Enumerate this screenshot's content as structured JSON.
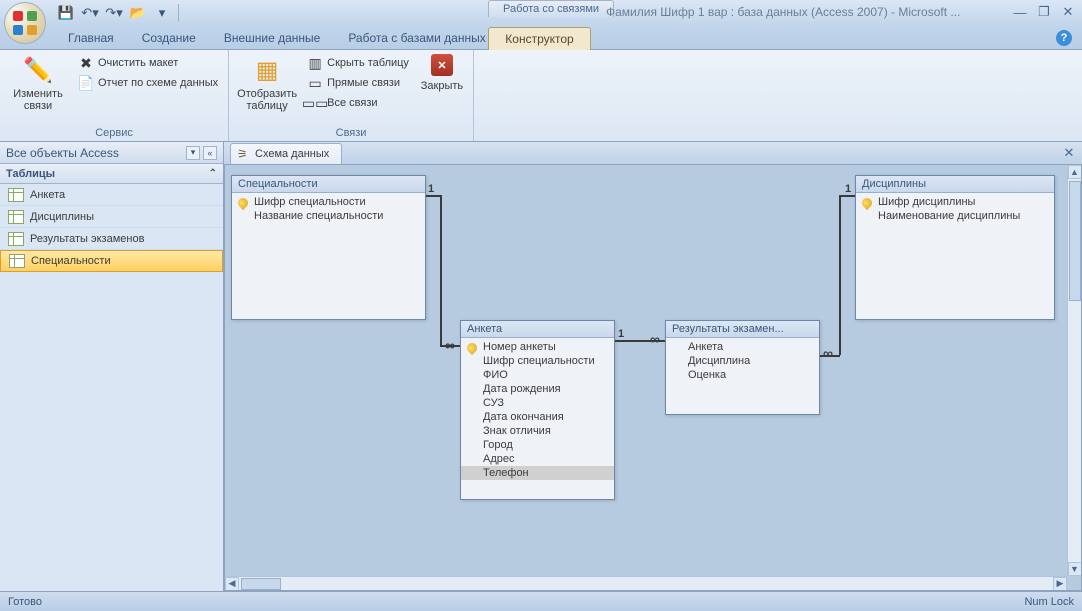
{
  "window": {
    "context_tab_title": "Работа со связями",
    "title": "Фамилия Шифр 1 вар : база данных (Access 2007) - Microsoft ..."
  },
  "qat": {
    "save": "save",
    "undo": "undo",
    "redo": "redo",
    "open": "open"
  },
  "tabs": {
    "home": "Главная",
    "create": "Создание",
    "external": "Внешние данные",
    "dbtools": "Работа с базами данных",
    "designer": "Конструктор"
  },
  "ribbon": {
    "group_service": "Сервис",
    "group_links": "Связи",
    "edit_links": "Изменить связи",
    "clear_layout": "Очистить макет",
    "schema_report": "Отчет по схеме данных",
    "show_table": "Отобразить таблицу",
    "hide_table": "Скрыть таблицу",
    "direct_links": "Прямые связи",
    "all_links": "Все связи",
    "close": "Закрыть"
  },
  "nav": {
    "header": "Все объекты Access",
    "section_tables": "Таблицы",
    "items": [
      "Анкета",
      "Дисциплины",
      "Результаты экзаменов",
      "Специальности"
    ],
    "selected_index": 3
  },
  "doc_tab": "Схема данных",
  "diagram": {
    "spec": {
      "title": "Специальности",
      "fields": [
        {
          "name": "Шифр специальности",
          "pk": true
        },
        {
          "name": "Название специальности",
          "pk": false
        }
      ]
    },
    "disc": {
      "title": "Дисциплины",
      "fields": [
        {
          "name": "Шифр дисциплины",
          "pk": true
        },
        {
          "name": "Наименование дисциплины",
          "pk": false
        }
      ]
    },
    "anketa": {
      "title": "Анкета",
      "fields": [
        {
          "name": "Номер анкеты",
          "pk": true
        },
        {
          "name": "Шифр специальности",
          "pk": false
        },
        {
          "name": "ФИО",
          "pk": false
        },
        {
          "name": "Дата рождения",
          "pk": false
        },
        {
          "name": "СУЗ",
          "pk": false
        },
        {
          "name": "Дата окончания",
          "pk": false
        },
        {
          "name": "Знак отличия",
          "pk": false
        },
        {
          "name": "Город",
          "pk": false
        },
        {
          "name": "Адрес",
          "pk": false
        },
        {
          "name": "Телефон",
          "pk": false,
          "sel": true
        }
      ]
    },
    "results": {
      "title": "Результаты экзамен...",
      "fields": [
        {
          "name": "Анкета",
          "pk": false
        },
        {
          "name": "Дисциплина",
          "pk": false
        },
        {
          "name": "Оценка",
          "pk": false
        }
      ]
    }
  },
  "status": {
    "ready": "Готово",
    "numlock": "Num Lock"
  }
}
